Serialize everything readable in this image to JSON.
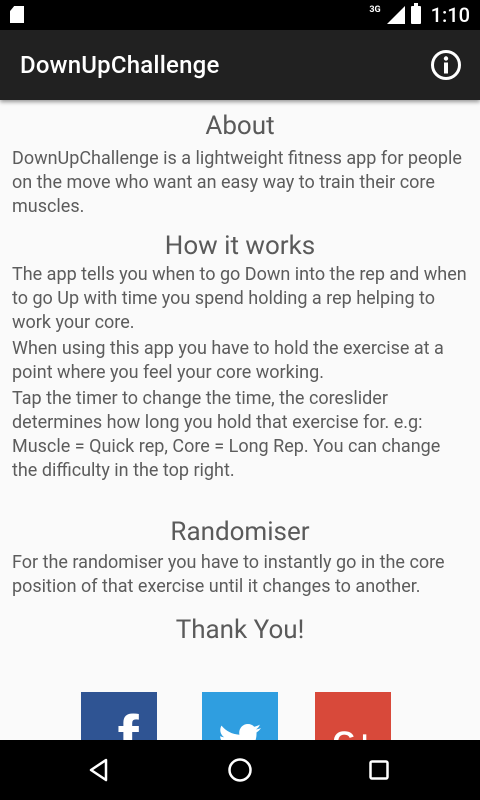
{
  "status_bar": {
    "network": "3G",
    "time": "1:10"
  },
  "app_bar": {
    "title": "DownUpChallenge",
    "info_icon": "info-icon"
  },
  "sections": {
    "about": {
      "title": "About",
      "text": "DownUpChallenge is a lightweight fitness app for people on the move who want an easy way to train their core muscles."
    },
    "how_it_works": {
      "title": "How it works",
      "paragraphs": [
        "The app tells you when to go Down into the rep and when to go Up with time you spend holding a rep helping to work your core.",
        "When using this app you have to hold the exercise at a point where you feel your core working.",
        "Tap the timer to change the time, the coreslider determines how long you hold that exercise for. e.g: Muscle = Quick rep, Core = Long Rep. You can change the difficulty in the top right."
      ]
    },
    "randomiser": {
      "title": "Randomiser",
      "text": "For the randomiser you have to instantly go in the core position of that exercise until it changes to another."
    },
    "thanks": {
      "title": "Thank You!"
    }
  },
  "social": {
    "facebook_label": "f",
    "twitter_icon": "twitter-bird-icon",
    "googleplus_label": "G+",
    "colors": {
      "facebook": "#2f5493",
      "twitter": "#2f9ee0",
      "googleplus": "#d8493a"
    }
  },
  "nav": {
    "back_icon": "back-triangle-icon",
    "home_icon": "home-circle-icon",
    "recents_icon": "recents-square-icon"
  }
}
